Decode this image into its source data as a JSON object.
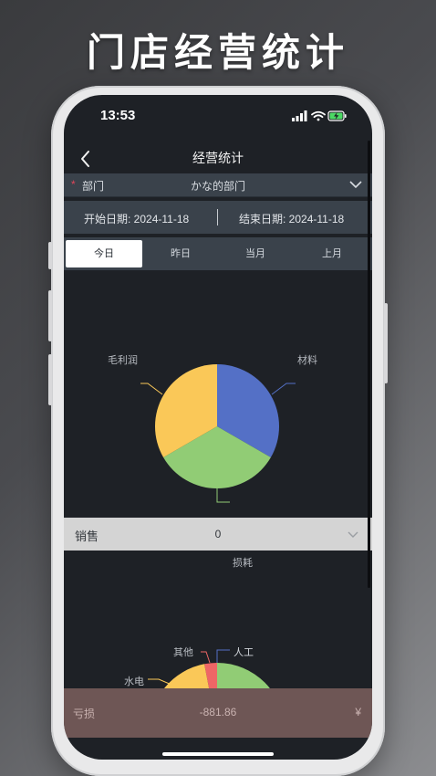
{
  "promo": {
    "title": "门店经营统计"
  },
  "status_bar": {
    "time": "13:53"
  },
  "nav": {
    "title": "经营统计"
  },
  "department": {
    "star": "*",
    "label": "部门",
    "value": "かな的部门"
  },
  "dates": {
    "start": "开始日期: 2024-11-18",
    "end": "结束日期: 2024-11-18"
  },
  "tabs": [
    {
      "label": "今日",
      "active": true
    },
    {
      "label": "昨日",
      "active": false
    },
    {
      "label": "当月",
      "active": false
    },
    {
      "label": "上月",
      "active": false
    }
  ],
  "pie1": {
    "type": "pie",
    "slices": [
      {
        "label": "材料",
        "value": 33.3,
        "color": "#5470c6"
      },
      {
        "label": "损耗",
        "value": 33.3,
        "color": "#91cc75"
      },
      {
        "label": "毛利润",
        "value": 33.3,
        "color": "#fac858"
      }
    ]
  },
  "sales": {
    "label": "销售",
    "value": "0"
  },
  "pie2": {
    "type": "pie",
    "slices": [
      {
        "label": "人工",
        "color": "#91cc75"
      },
      {
        "label": "水电",
        "color": "#fac858"
      },
      {
        "label": "其他",
        "color": "#ee6666"
      }
    ]
  },
  "loss": {
    "label": "亏损",
    "value": "-881.86",
    "unit": "¥"
  },
  "colors": {
    "screen_bg": "#1e2126",
    "panel_bg": "#3a424b",
    "loss_bg": "#6e5655"
  }
}
